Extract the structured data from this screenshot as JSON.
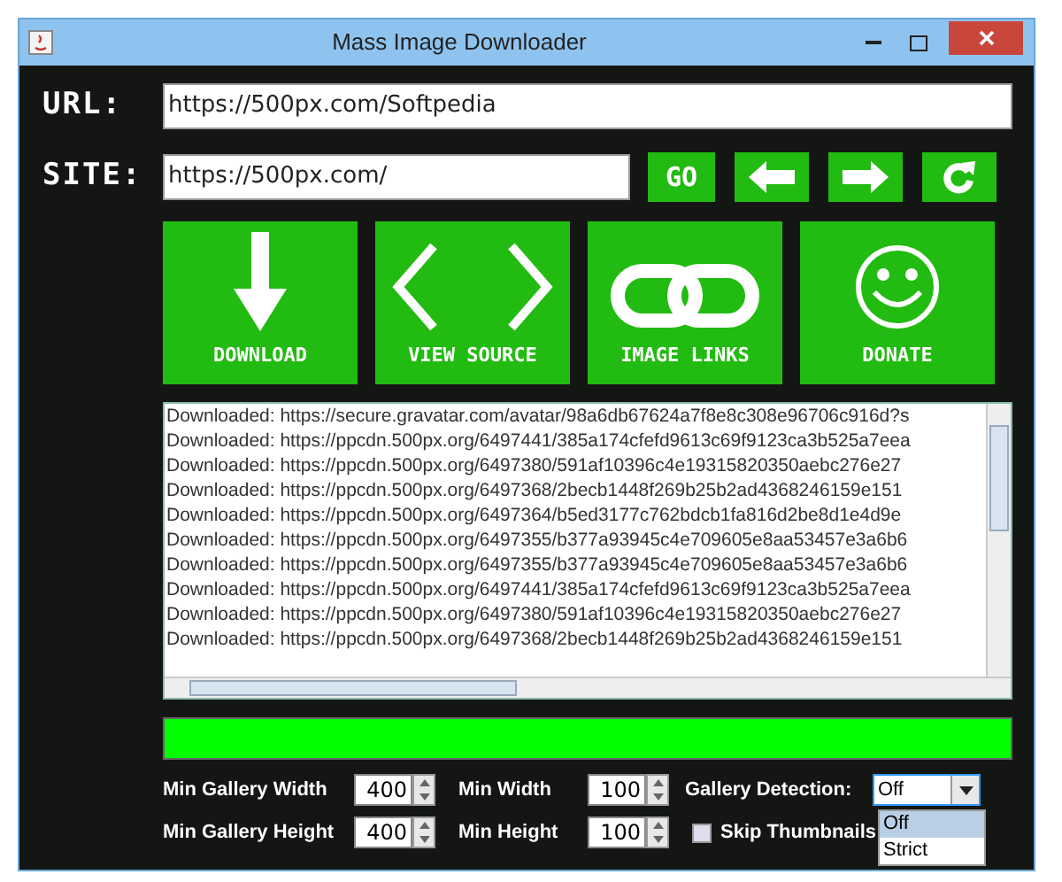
{
  "window": {
    "title": "Mass Image Downloader"
  },
  "url": {
    "label": "URL:",
    "value": "https://500px.com/Softpedia"
  },
  "site": {
    "label": "SITE:",
    "value": "https://500px.com/"
  },
  "nav_buttons": [
    {
      "kind": "go",
      "label": "GO"
    },
    {
      "kind": "back"
    },
    {
      "kind": "forward"
    },
    {
      "kind": "refresh"
    }
  ],
  "actions": [
    {
      "kind": "download",
      "label": "DOWNLOAD"
    },
    {
      "kind": "source",
      "label": "VIEW SOURCE"
    },
    {
      "kind": "links",
      "label": "IMAGE LINKS"
    },
    {
      "kind": "donate",
      "label": "DONATE"
    }
  ],
  "log": {
    "lines": [
      "Downloaded: https://secure.gravatar.com/avatar/98a6db67624a7f8e8c308e96706c916d?s",
      "Downloaded: https://ppcdn.500px.org/6497441/385a174cfefd9613c69f9123ca3b525a7eea",
      "Downloaded: https://ppcdn.500px.org/6497380/591af10396c4e19315820350aebc276e27",
      "Downloaded: https://ppcdn.500px.org/6497368/2becb1448f269b25b2ad4368246159e151",
      "Downloaded: https://ppcdn.500px.org/6497364/b5ed3177c762bdcb1fa816d2be8d1e4d9e",
      "Downloaded: https://ppcdn.500px.org/6497355/b377a93945c4e709605e8aa53457e3a6b6",
      "Downloaded: https://ppcdn.500px.org/6497355/b377a93945c4e709605e8aa53457e3a6b6",
      "Downloaded: https://ppcdn.500px.org/6497441/385a174cfefd9613c69f9123ca3b525a7eea",
      "Downloaded: https://ppcdn.500px.org/6497380/591af10396c4e19315820350aebc276e27",
      "Downloaded: https://ppcdn.500px.org/6497368/2becb1448f269b25b2ad4368246159e151"
    ]
  },
  "progress": {
    "level": 1
  },
  "settings": {
    "min_gallery_width": {
      "label": "Min Gallery Width",
      "value": "400"
    },
    "min_width": {
      "label": "Min Width",
      "value": "100"
    },
    "min_gallery_height": {
      "label": "Min Gallery Height",
      "value": "400"
    },
    "min_height": {
      "label": "Min Height",
      "value": "100"
    },
    "gallery_detection": {
      "label": "Gallery Detection:",
      "value": "Off",
      "expanded": true,
      "options": [
        {
          "label": "Off",
          "selected": true
        },
        {
          "label": "Strict",
          "selected": false
        }
      ]
    },
    "skip_thumbnails": {
      "label": "Skip Thumbnails",
      "checked": false
    }
  }
}
